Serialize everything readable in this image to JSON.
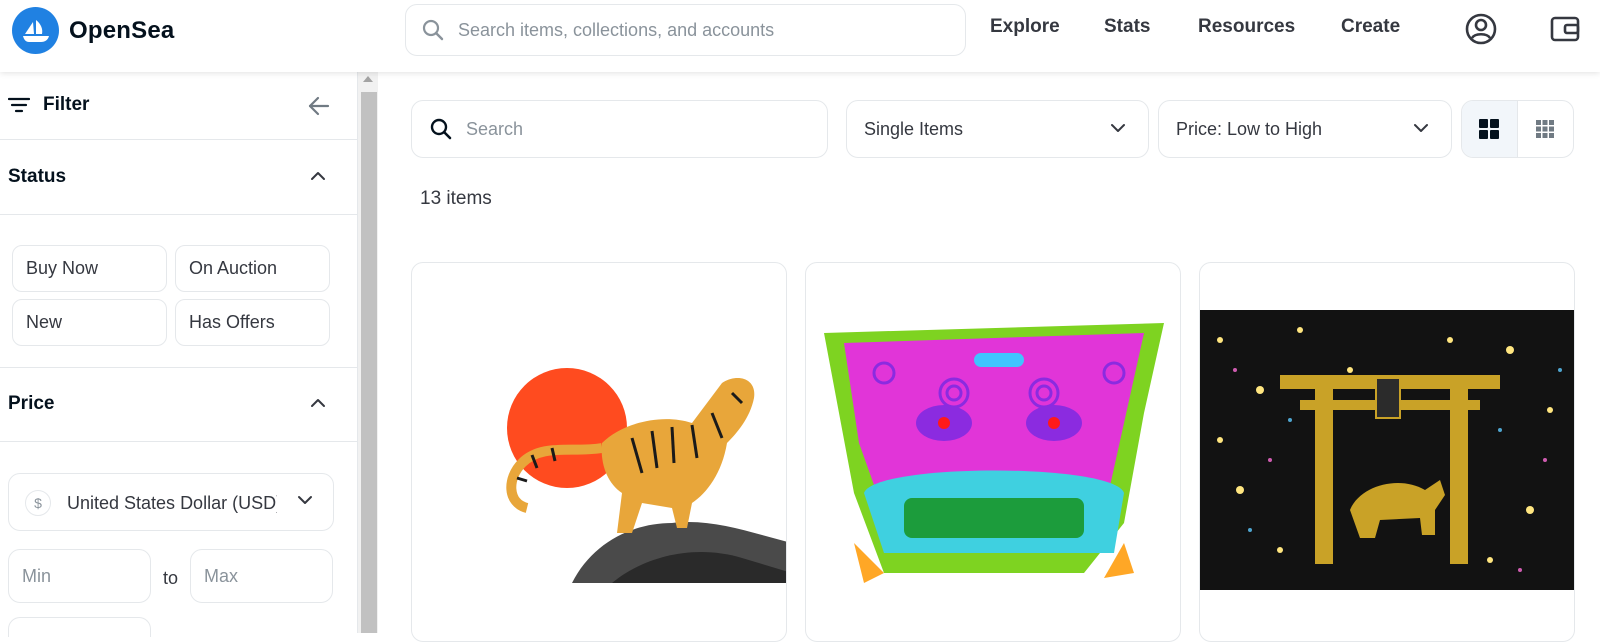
{
  "brand": {
    "name": "OpenSea",
    "logo_color": "#2081e2"
  },
  "topnav": {
    "search_placeholder": "Search items, collections, and accounts",
    "links": [
      "Explore",
      "Stats",
      "Resources",
      "Create"
    ],
    "icons": [
      "profile-icon",
      "wallet-icon"
    ]
  },
  "sidebar": {
    "filter_label": "Filter",
    "status": {
      "title": "Status",
      "options": [
        "Buy Now",
        "On Auction",
        "New",
        "Has Offers"
      ]
    },
    "price": {
      "title": "Price",
      "currency_symbol": "$",
      "currency": "United States Dollar (USD)",
      "min_placeholder": "Min",
      "max_placeholder": "Max",
      "to_label": "to"
    }
  },
  "main": {
    "search_placeholder": "Search",
    "item_type": "Single Items",
    "sort": "Price: Low to High",
    "item_count": "13 items",
    "cards": [
      {
        "art": "tiger-with-red-sun"
      },
      {
        "art": "pink-lion-dog-mask"
      },
      {
        "art": "golden-torii-tiger-sparkles"
      }
    ]
  },
  "colors": {
    "accent": "#2081e2",
    "border": "#e5e8eb",
    "text": "#04111d",
    "muted": "#8a939b"
  }
}
